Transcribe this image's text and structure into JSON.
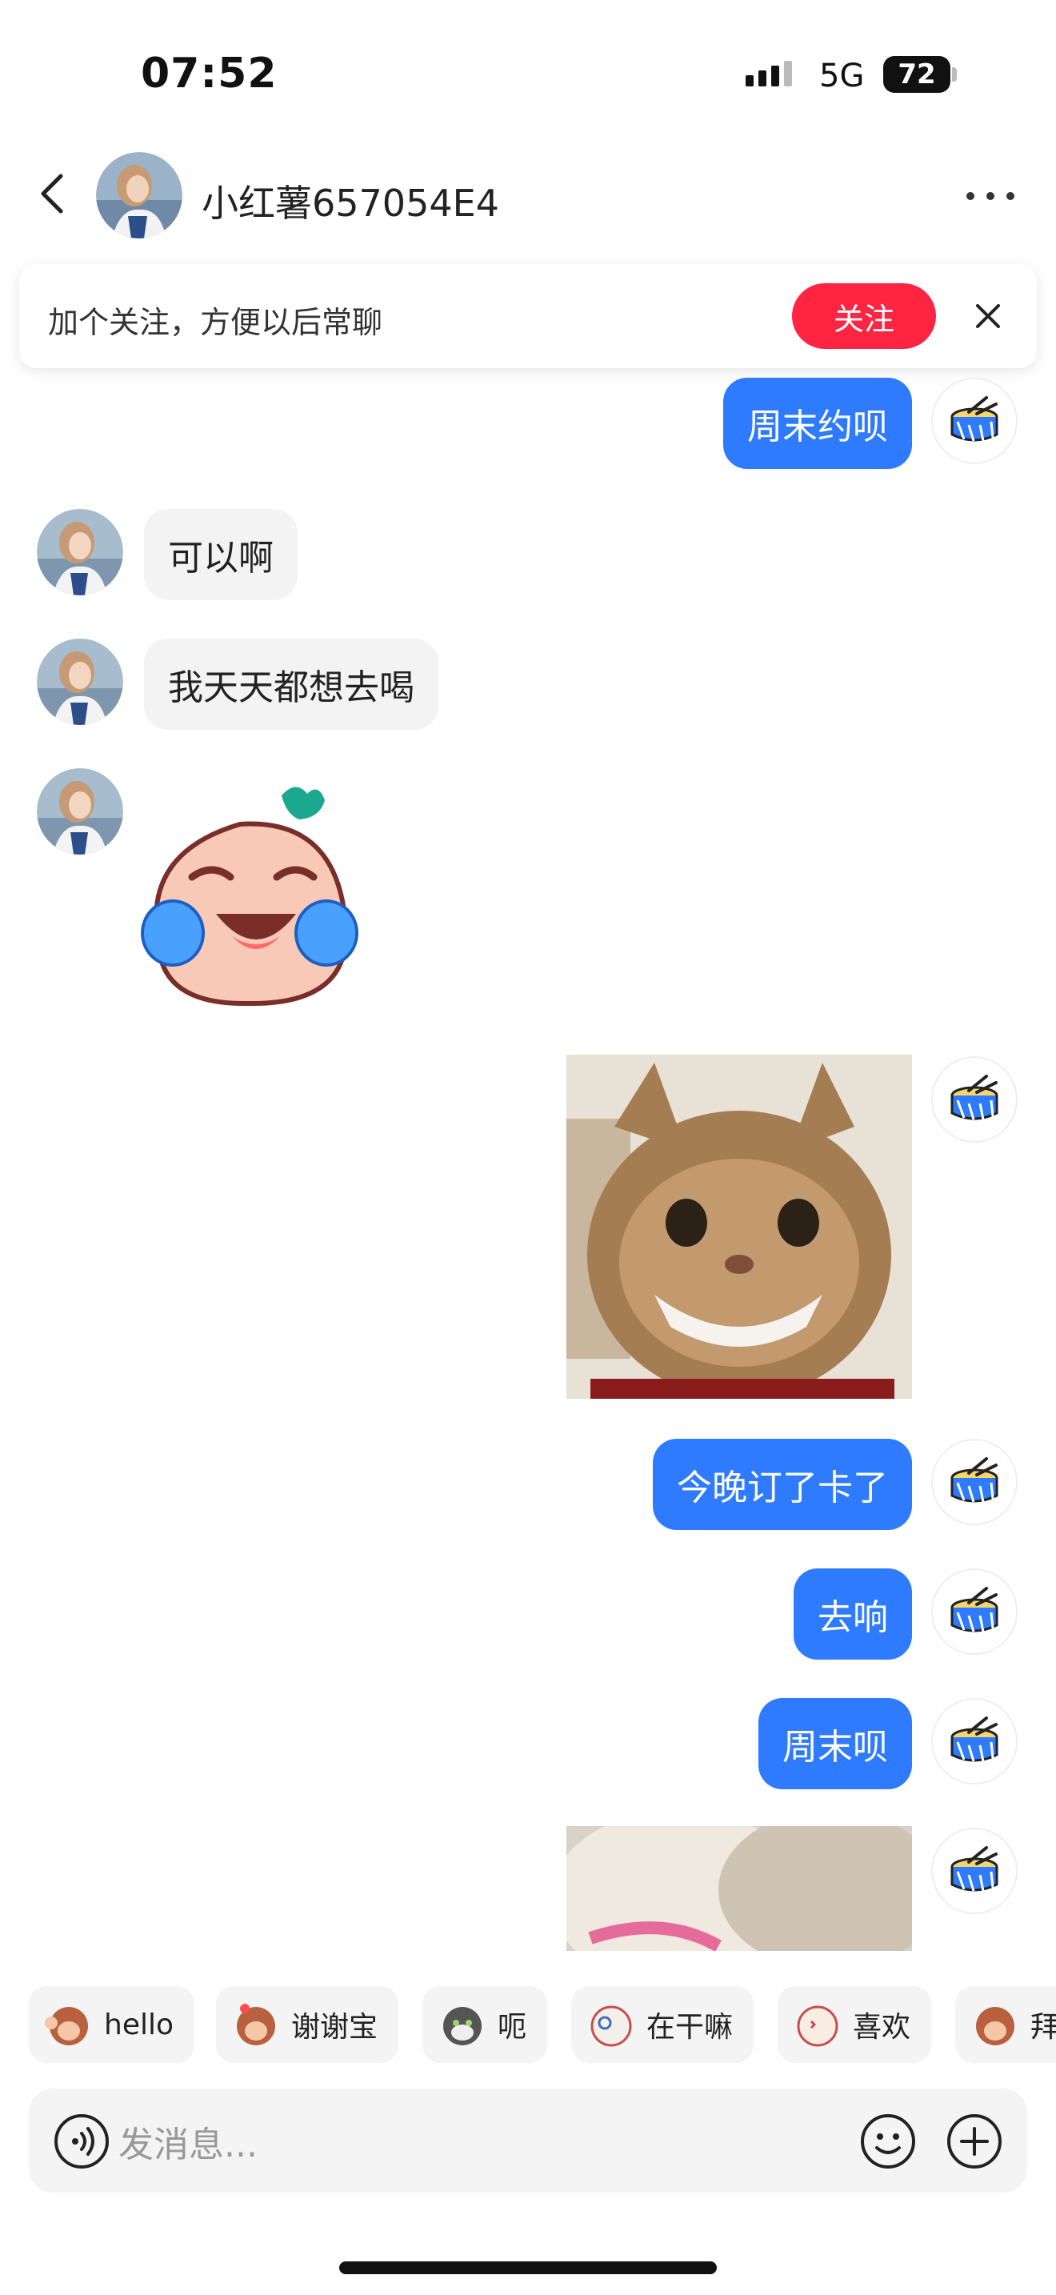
{
  "status": {
    "time": "07:52",
    "network": "5G",
    "battery": "72"
  },
  "header": {
    "title": "小红薯657054E4"
  },
  "banner": {
    "text": "加个关注，方便以后常聊",
    "follow_label": "关注"
  },
  "messages": {
    "m1": "周末约呗",
    "m2": "可以啊",
    "m3": "我天天都想去喝",
    "m6": "今晚订了卡了",
    "m7": "去响",
    "m8": "周末呗"
  },
  "quick_replies": [
    "hello",
    "谢谢宝",
    "呃",
    "在干嘛",
    "喜欢",
    "拜"
  ],
  "input": {
    "placeholder": "发消息..."
  },
  "colors": {
    "accent_blue": "#2f7bff",
    "follow_red": "#ff2442",
    "bubble_grey": "#f3f3f3"
  },
  "icons": [
    "back-arrow-icon",
    "more-dots-icon",
    "close-icon",
    "drum-avatar-icon",
    "voice-icon",
    "emoji-icon",
    "plus-icon"
  ]
}
